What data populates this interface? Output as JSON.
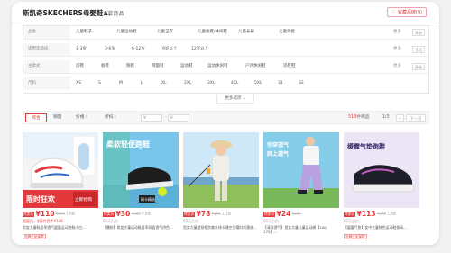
{
  "header": {
    "store_name": "斯凯奇SKECHERS母婴鞋...",
    "count_value": "5",
    "count_label": "款商品",
    "favorite_label": "收藏品牌(9)"
  },
  "filters": {
    "rows": [
      {
        "label": "品类",
        "options": [
          "儿童鞋子",
          "儿童运动鞋",
          "儿童卫衣",
          "儿童板鞋/休闲鞋",
          "儿童长裤",
          "儿童外套"
        ]
      },
      {
        "label": "适用年龄段",
        "options": [
          "1-3岁",
          "3-6岁",
          "6-12岁",
          "9岁以上",
          "12岁以上"
        ]
      },
      {
        "label": "主款式",
        "options": [
          "灯鞋",
          "板鞋",
          "跑鞋",
          "网面鞋",
          "运动鞋",
          "运动休闲鞋",
          "户外休闲鞋",
          "凉鞋鞋"
        ]
      },
      {
        "label": "尺码",
        "options": [
          "XS",
          "S",
          "M",
          "L",
          "XL",
          "2XL",
          "3XL",
          "4XL",
          "5XL",
          "31",
          "32"
        ]
      }
    ],
    "more_label": "更多",
    "multi_label": "多选"
  },
  "more_selection_label": "更多选项",
  "sortbar": {
    "items": [
      "综合",
      "销量",
      "价格",
      "折扣"
    ],
    "price_from": "¥",
    "price_to": "¥",
    "total_value": "518",
    "total_label": "件商品",
    "page": "1/3",
    "prev_label": "<",
    "next_label": "下一页"
  },
  "products": [
    {
      "tag": "特卖价",
      "price": "¥110",
      "old": "¥699",
      "disc": "1.6折",
      "sub": "限量抢，前3件到手¥148",
      "name": "男女大童鞋夏季透气缓震运动跑鞋小白...",
      "badge": "品牌正品保障",
      "img_text": "限时狂欢",
      "img_text2": "立即抢购"
    },
    {
      "tag": "特卖价",
      "price": "¥30",
      "old": "¥399",
      "disc": "0.8折",
      "sub": "60天价价",
      "name": "【爆款】男女大童运动鞋夏季网面透气拼色...",
      "badge": "",
      "img_text": "柔软轻便跑鞋",
      "img_text2": "网卡精选"
    },
    {
      "tag": "特卖价",
      "price": "¥78",
      "old": "¥399",
      "disc": "1.1折",
      "sub": "60天价价",
      "name": "男女大童遮阳帽防紫外线卡通空顶帽时尚潮流...",
      "badge": "",
      "img_text": "",
      "img_text2": ""
    },
    {
      "tag": "特卖价",
      "price": "¥24",
      "old": "¥299",
      "disc": "",
      "sub": "60天价价",
      "name": "【清凉透气】男女大童儿童运动裤【100-170】...",
      "badge": "",
      "img_text": "你穿透气",
      "img_text2": "网上透气"
    },
    {
      "tag": "特卖价",
      "price": "¥113",
      "old": "¥399",
      "disc": "1.8折",
      "sub": "60天价价",
      "name": "【缓震气垫】女中大童拼色运动鞋休闲...",
      "badge": "品牌正品保障",
      "img_text": "缓震气垫跑鞋",
      "img_text2": ""
    }
  ]
}
